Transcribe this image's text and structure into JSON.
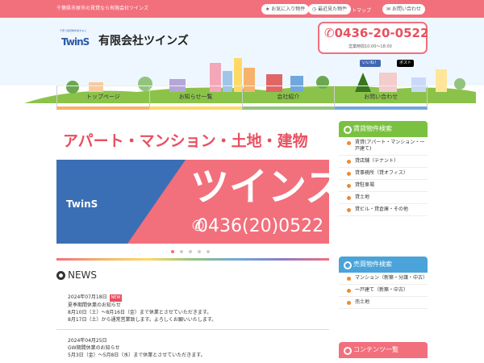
{
  "topbar": {
    "tagline": "千葉県市原市の賃貸なら有限会社ツインズ",
    "favorites": "お気に入り物件",
    "history": "最近見た物件",
    "sitemap": "サイトマップ",
    "contact": "お問い合わせ"
  },
  "header": {
    "logo_small": "千葉で賃貸物件探すなら",
    "logo": "TwinS",
    "company": "有限会社ツインズ",
    "phone": "0436-20-0522",
    "hours": "営業時間10:00～18:00",
    "like": "いいね！",
    "post": "ポスト"
  },
  "nav": [
    "トップページ",
    "お知らせ一覧",
    "会社紹介",
    "お問い合わせ"
  ],
  "slider": {
    "headline": "アパート・マンション・土地・建物",
    "brand": "ツインズ",
    "logo": "TwinS",
    "tel": "0436(20)0522"
  },
  "news": {
    "title": "NEWS",
    "new_label": "NEW",
    "items": [
      {
        "date": "2024年07月18日",
        "title": "夏季期間休業のお知らせ",
        "lines": [
          "8月10日（土）～8月16日（金）まで休業とさせていただきます。",
          "8月17日（土）から通常営業致します。よろしくお願いいたします。"
        ]
      },
      {
        "date": "2024年04月25日",
        "title": "GW期間休業のお知らせ",
        "lines": [
          "5月3日（金）～5月8日（水）まで休業とさせていただきます。"
        ]
      }
    ]
  },
  "sidebar": {
    "rent": {
      "title": "賃貸物件検索",
      "items": [
        "賃貸(アパート・マンション・一戸建て)",
        "貸店舗（テナント）",
        "貸事務所（貸オフィス）",
        "貸駐車場",
        "貸土地",
        "貸ビル・貸倉庫・その他"
      ]
    },
    "sale": {
      "title": "売買物件検索",
      "items": [
        "マンション（新築・分譲・中古）",
        "一戸建て（新築・中古）",
        "売土地"
      ]
    },
    "contents": {
      "title": "コンテンツ一覧"
    }
  },
  "colors": {
    "accent": "#f26f7c",
    "green": "#7ac142",
    "blue": "#4aa3d9",
    "brand_blue": "#3a6fb5"
  }
}
